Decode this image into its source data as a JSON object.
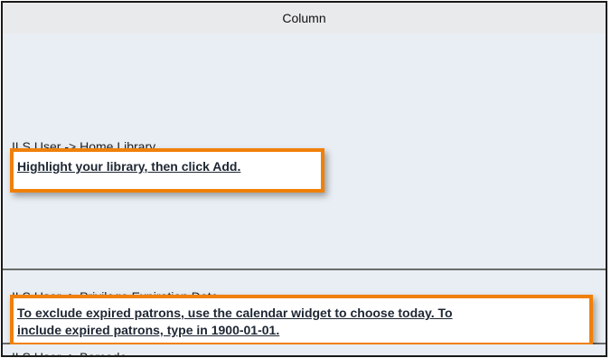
{
  "table": {
    "column_header": "Column",
    "rows": [
      {
        "field_label": "ILS User -> Home Library",
        "instruction": "Highlight your library, then click Add."
      },
      {
        "field_label": "ILS User -> Privilege Expiration Date",
        "instruction_line1": "To exclude expired patrons, use the calendar widget to choose today. To",
        "instruction_line2": "include expired patrons, type in 1900-01-01."
      },
      {
        "field_label": "ILS User -> Barcode"
      }
    ]
  },
  "colors": {
    "callout_border": "#f0800a",
    "row_background": "#e8eef3",
    "text": "#1e2733"
  }
}
